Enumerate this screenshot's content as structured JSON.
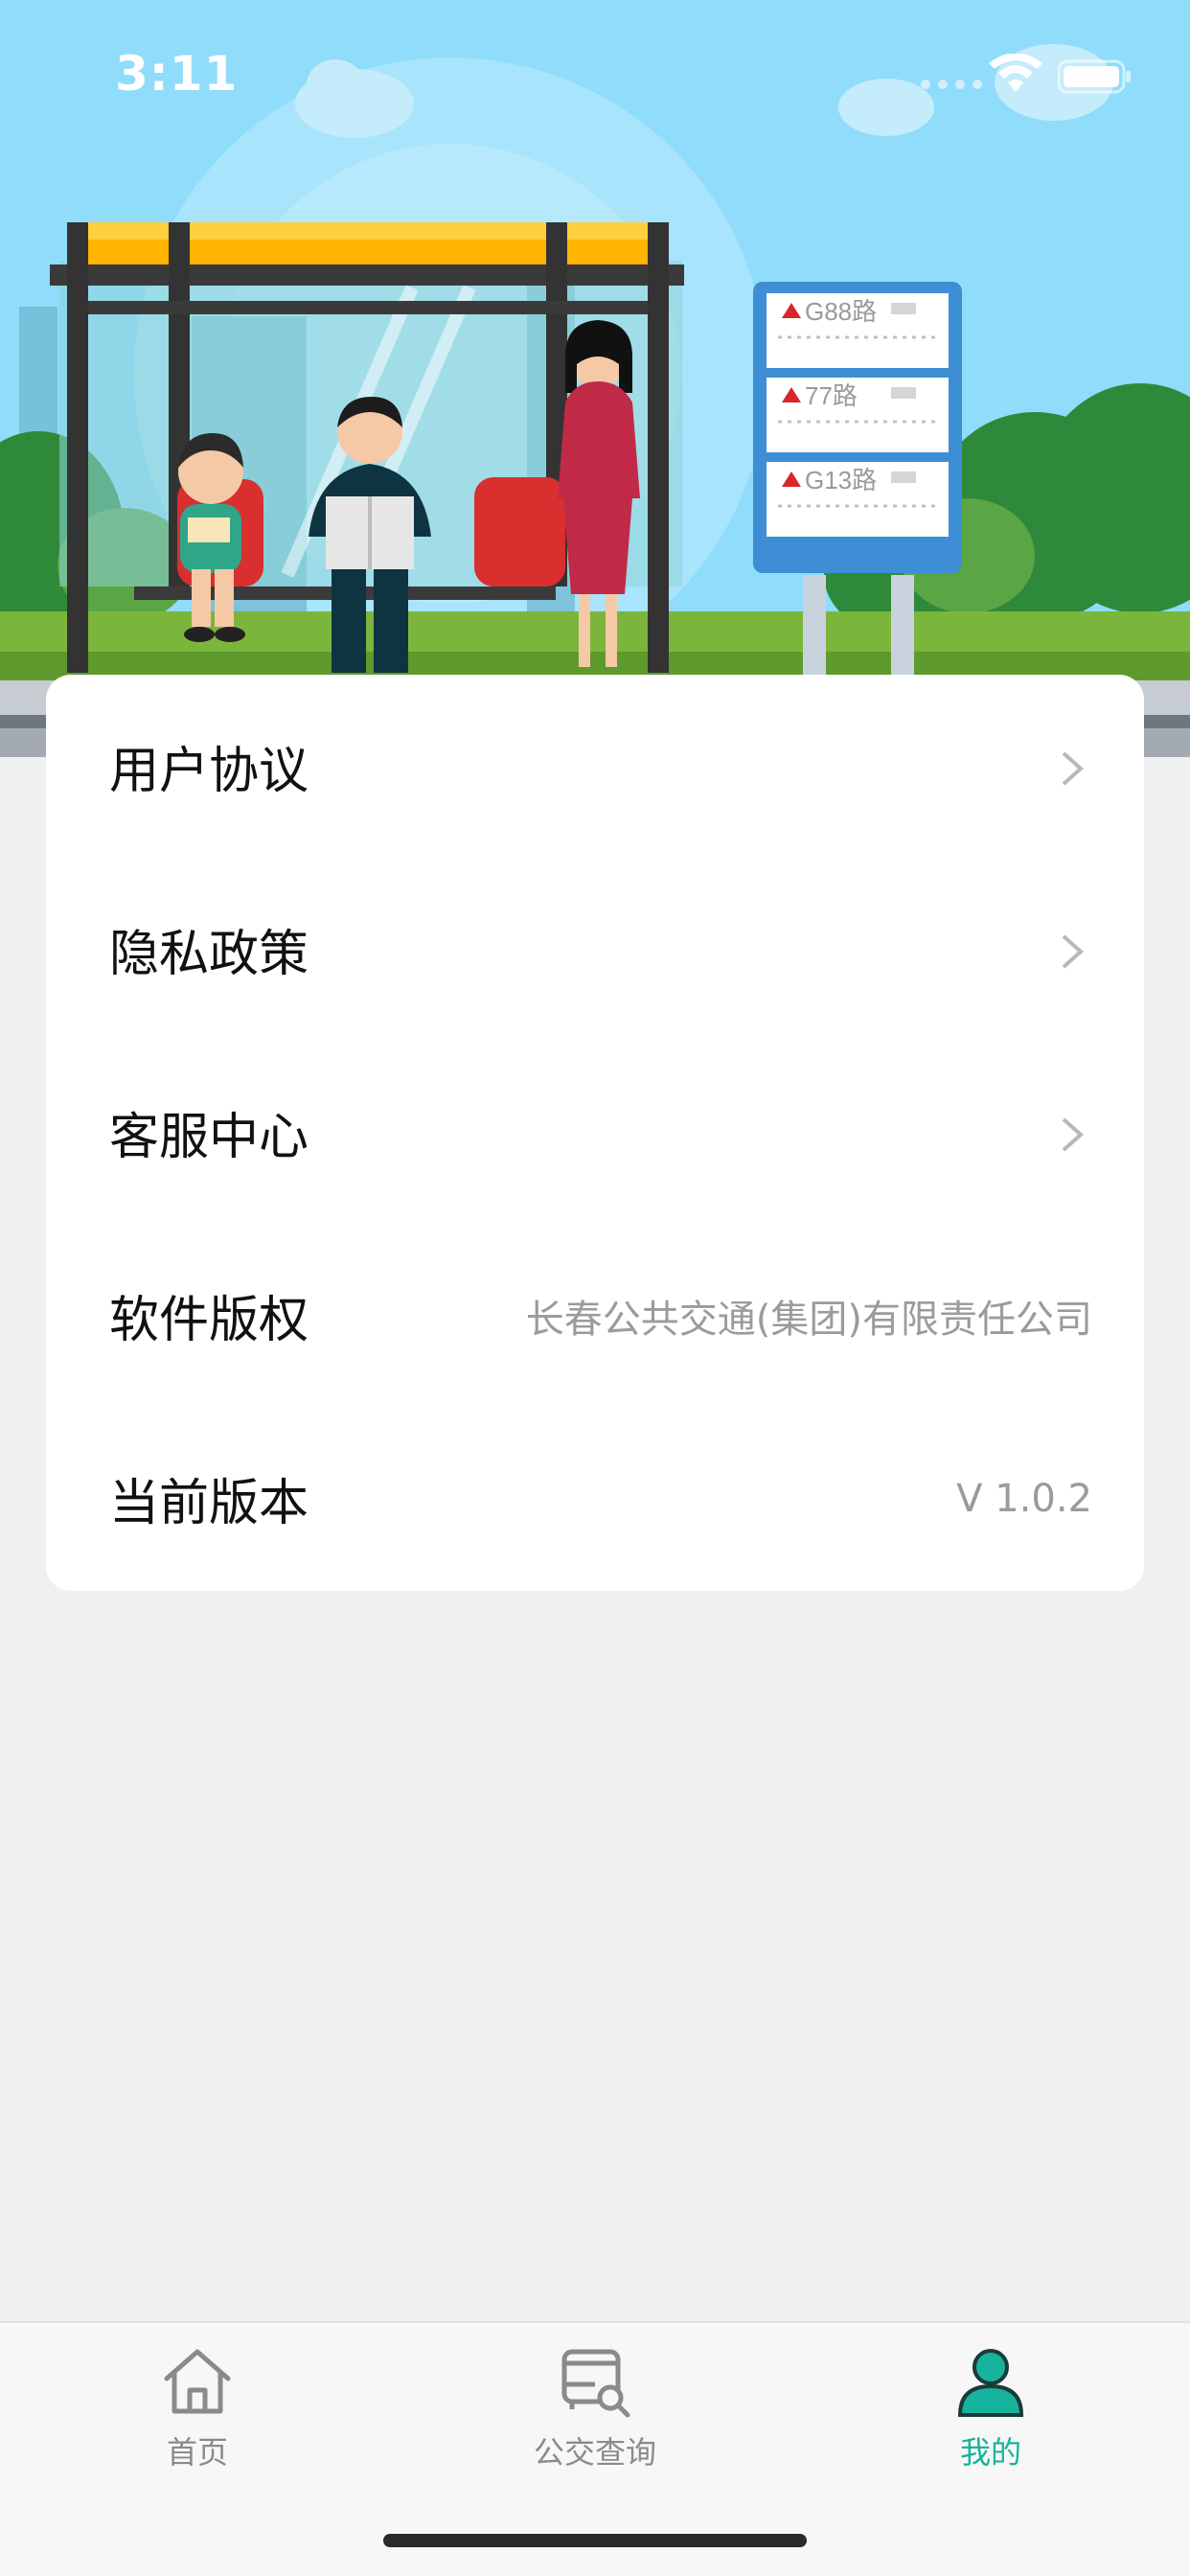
{
  "status_bar": {
    "time": "3:11"
  },
  "hero": {
    "route_signs": [
      "G88路",
      "77路",
      "G13路"
    ]
  },
  "menu": {
    "items": [
      {
        "label": "用户协议",
        "value": "",
        "has_chevron": true
      },
      {
        "label": "隐私政策",
        "value": "",
        "has_chevron": true
      },
      {
        "label": "客服中心",
        "value": "",
        "has_chevron": true
      },
      {
        "label": "软件版权",
        "value": "长春公共交通(集团)有限责任公司",
        "has_chevron": false
      },
      {
        "label": "当前版本",
        "value": "V 1.0.2",
        "has_chevron": false
      }
    ]
  },
  "tabbar": {
    "tabs": [
      {
        "label": "首页",
        "icon": "home-icon",
        "active": false
      },
      {
        "label": "公交查询",
        "icon": "bus-search-icon",
        "active": false
      },
      {
        "label": "我的",
        "icon": "person-icon",
        "active": true
      }
    ]
  },
  "colors": {
    "accent": "#16b39d",
    "background": "#eff0f2",
    "sky": "#8fdcfb"
  }
}
